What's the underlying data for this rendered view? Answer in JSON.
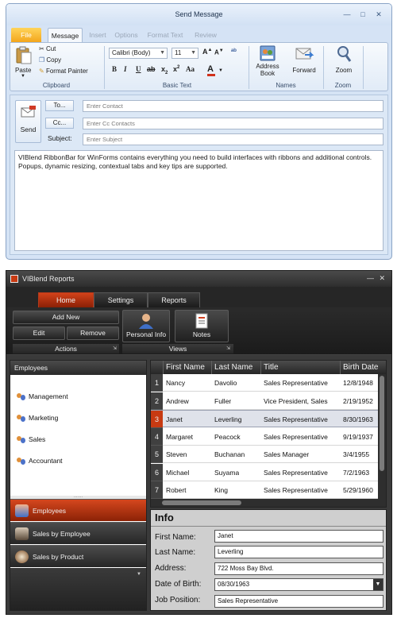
{
  "send_window": {
    "title": "Send Message",
    "tabs": [
      "File",
      "Message",
      "Insert",
      "Options",
      "Format Text",
      "Review"
    ],
    "clipboard": {
      "paste": "Paste",
      "cut": "Cut",
      "copy": "Copy",
      "format_painter": "Format Painter",
      "label": "Clipboard"
    },
    "basic_text": {
      "font": "Calibri (Body)",
      "size": "11",
      "label": "Basic Text",
      "bold": "B",
      "italic": "I",
      "underline": "U",
      "case": "Aa"
    },
    "names": {
      "address_book": "Address Book",
      "forward": "Forward",
      "label": "Names"
    },
    "zoom": {
      "button": "Zoom",
      "label": "Zoom"
    },
    "compose": {
      "send": "Send",
      "to": "To...",
      "cc": "Cc...",
      "subject": "Subject:",
      "to_placeholder": "Enter Contact",
      "cc_placeholder": "Enter Cc Contacts",
      "subject_placeholder": "Enter Subject",
      "body_line1": "VIBlend RibbonBar for WinForms contains everything you need to build interfaces with ribbons and additional controls.",
      "body_line2": "Popups, dynamic resizing, contextual tabs and key tips are supported."
    }
  },
  "reports_window": {
    "title": "VIBlend Reports",
    "tabs": [
      "Home",
      "Settings",
      "Reports"
    ],
    "actions": {
      "add_new": "Add New",
      "edit": "Edit",
      "remove": "Remove",
      "label": "Actions"
    },
    "views": {
      "personal_info": "Personal Info",
      "notes": "Notes",
      "label": "Views"
    },
    "sidebar": {
      "header": "Employees",
      "items": [
        "Management",
        "Marketing",
        "Sales",
        "Accountant"
      ],
      "nav": [
        "Employees",
        "Sales by Employee",
        "Sales by Product"
      ]
    },
    "grid": {
      "columns": [
        "First Name",
        "Last Name",
        "Title",
        "Birth Date"
      ],
      "rows": [
        {
          "n": "1",
          "first": "Nancy",
          "last": "Davolio",
          "title": "Sales Representative",
          "birth": "12/8/1948"
        },
        {
          "n": "2",
          "first": "Andrew",
          "last": "Fuller",
          "title": "Vice President, Sales",
          "birth": "2/19/1952"
        },
        {
          "n": "3",
          "first": "Janet",
          "last": "Leverling",
          "title": "Sales Representative",
          "birth": "8/30/1963"
        },
        {
          "n": "4",
          "first": "Margaret",
          "last": "Peacock",
          "title": "Sales Representative",
          "birth": "9/19/1937"
        },
        {
          "n": "5",
          "first": "Steven",
          "last": "Buchanan",
          "title": "Sales Manager",
          "birth": "3/4/1955"
        },
        {
          "n": "6",
          "first": "Michael",
          "last": "Suyama",
          "title": "Sales Representative",
          "birth": "7/2/1963"
        },
        {
          "n": "7",
          "first": "Robert",
          "last": "King",
          "title": "Sales Representative",
          "birth": "5/29/1960"
        }
      ]
    },
    "info": {
      "title": "Info",
      "labels": [
        "First Name:",
        "Last Name:",
        "Address:",
        "Date of Birth:",
        "Job Position:"
      ],
      "first_name": "Janet",
      "last_name": "Leverling",
      "address": "722 Moss Bay Blvd.",
      "dob": "08/30/1963",
      "job": "Sales Representative"
    }
  }
}
